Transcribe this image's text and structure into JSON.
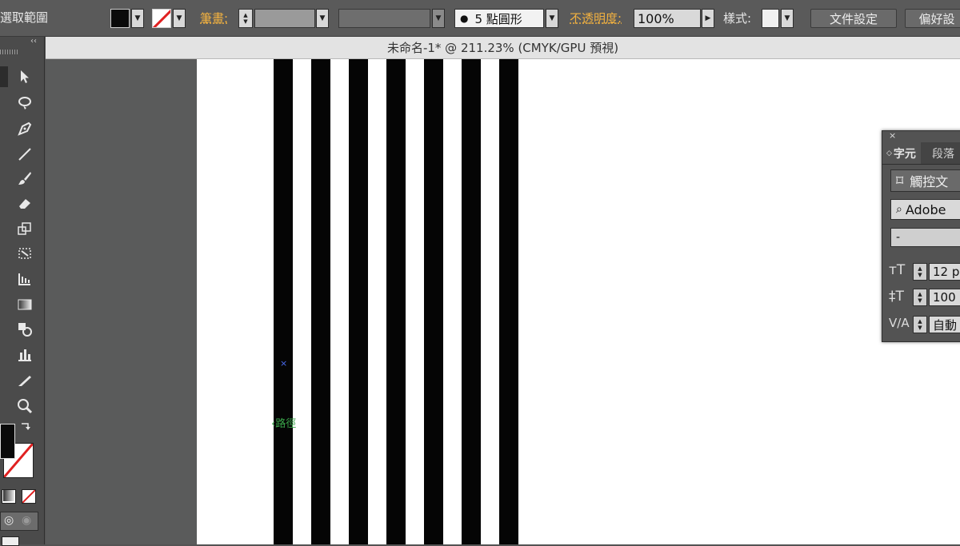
{
  "control_bar": {
    "selection_label": "選取範圍",
    "stroke_label": "筆畫:",
    "brush_profile": "5 點圓形",
    "opacity_label": "不透明度:",
    "opacity_value": "100%",
    "style_label": "樣式:",
    "document_setup_button": "文件設定",
    "preferences_button": "偏好設"
  },
  "document": {
    "tab_title": "未命名-1* @ 211.23% (CMYK/GPU 預視)",
    "path_hint": "路徑",
    "anchor_marker": "×"
  },
  "tools": {
    "panel_collapse": "‹‹"
  },
  "character_panel": {
    "close": "×",
    "tab_character": "字元",
    "tab_paragraph": "段落",
    "touch_type_button": "觸控文",
    "font_family": "Adobe",
    "font_style": "-",
    "font_size": "12 p",
    "leading": "100",
    "kerning": "自動"
  },
  "colors": {
    "fill": "#0a0a0a",
    "stroke_none_slash": "#e02020",
    "accent_orange": "#f0b040",
    "artboard": "#ffffff",
    "pasteboard": "#5a5b5b"
  }
}
